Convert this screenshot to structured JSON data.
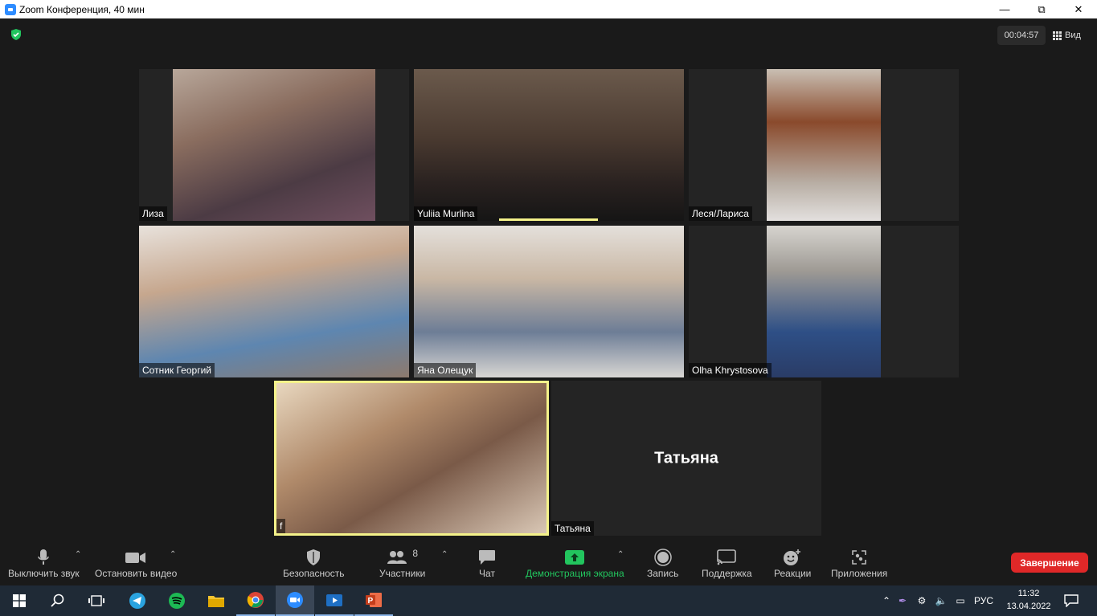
{
  "window": {
    "title": "Zoom Конференция, 40 мин"
  },
  "header": {
    "timer": "00:04:57",
    "view_label": "Вид"
  },
  "participants": [
    {
      "name": "Лиза"
    },
    {
      "name": "Yuliia Murlina"
    },
    {
      "name": "Леся/Лариса"
    },
    {
      "name": "Сотник Георгий"
    },
    {
      "name": "Яна Олещук"
    },
    {
      "name": "Olha Khrystosova"
    },
    {
      "name": "f"
    },
    {
      "name": "Татьяна",
      "display_name": "Татьяна"
    }
  ],
  "toolbar": {
    "mute": "Выключить звук",
    "video": "Остановить видео",
    "security": "Безопасность",
    "participants": "Участники",
    "participants_count": "8",
    "chat": "Чат",
    "share": "Демонстрация экрана",
    "record": "Запись",
    "support": "Поддержка",
    "reactions": "Реакции",
    "apps": "Приложения",
    "end": "Завершение"
  },
  "taskbar": {
    "lang": "РУС",
    "time": "11:32",
    "date": "13.04.2022"
  },
  "colors": {
    "active_speaker": "#f4f28a",
    "share_green": "#22c55e",
    "end_red": "#e02828"
  }
}
